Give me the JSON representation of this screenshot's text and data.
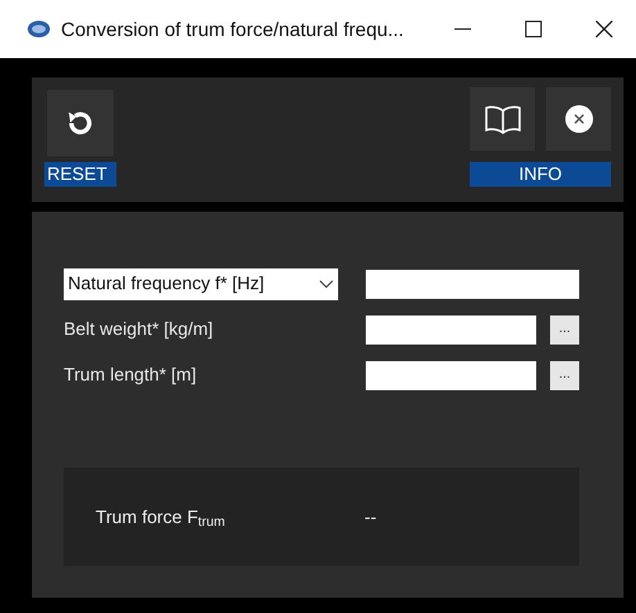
{
  "window": {
    "title": "Conversion of trum force/natural frequ..."
  },
  "toolbar": {
    "reset_label": "RESET",
    "info_label": "INFO"
  },
  "form": {
    "mode_select": {
      "value": "Natural frequency f* [Hz]"
    },
    "fields": [
      {
        "kind": "plain"
      },
      {
        "kind": "browse",
        "label": "Belt weight* [kg/m]",
        "button": "..."
      },
      {
        "kind": "browse",
        "label": "Trum length* [m]",
        "button": "..."
      }
    ]
  },
  "result": {
    "label": "Trum force F$_{trum}$",
    "value": "--"
  }
}
